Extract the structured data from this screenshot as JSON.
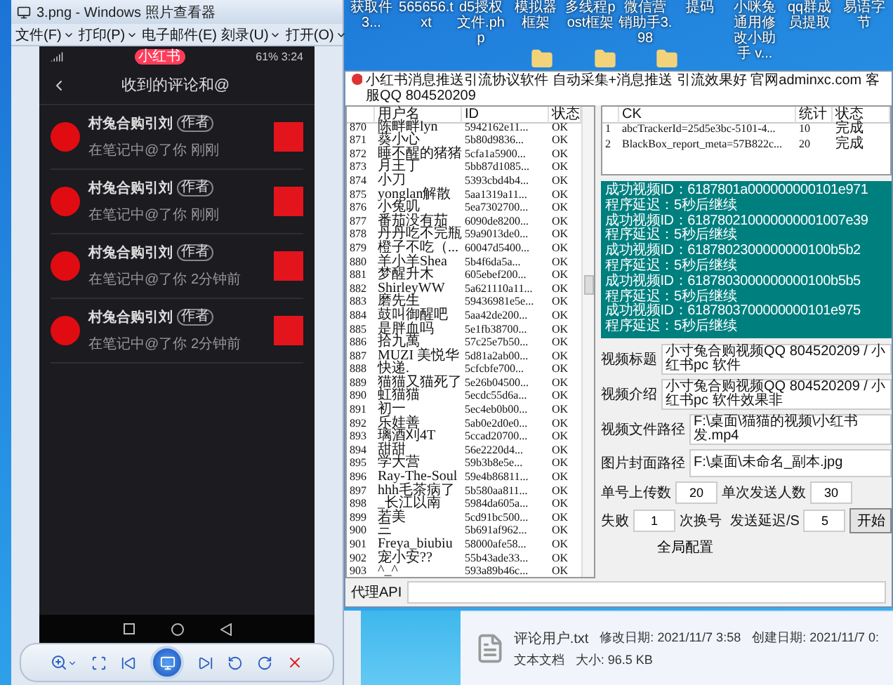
{
  "photo_viewer": {
    "title": "3.png - Windows 照片查看器",
    "menu": [
      {
        "label": "文件(F)",
        "dropdown": true
      },
      {
        "label": "打印(P)",
        "dropdown": true
      },
      {
        "label": "电子邮件(E)",
        "dropdown": false
      },
      {
        "label": "刻录(U)",
        "dropdown": true
      },
      {
        "label": "打开(O)",
        "dropdown": true
      }
    ],
    "phone": {
      "status_badge": "小红书",
      "battery": "61%",
      "time": "3:24",
      "header": "收到的评论和@",
      "comments": [
        {
          "name": "村兔合购引刘",
          "tag": "作者",
          "text": "在笔记中@了你",
          "time": "刚刚"
        },
        {
          "name": "村兔合购引刘",
          "tag": "作者",
          "text": "在笔记中@了你",
          "time": "刚刚"
        },
        {
          "name": "村兔合购引刘",
          "tag": "作者",
          "text": "在笔记中@了你",
          "time": "2分钟前"
        },
        {
          "name": "村兔合购引刘",
          "tag": "作者",
          "text": "在笔记中@了你",
          "time": "2分钟前"
        }
      ]
    }
  },
  "desktop_icons": [
    {
      "label": "获取件3..."
    },
    {
      "label": "565656.txt"
    },
    {
      "label": "d5授权文件.php"
    },
    {
      "label": "模拟器框架"
    },
    {
      "label": "多线程post框架"
    },
    {
      "label": "微信营销助手3.98"
    },
    {
      "label": "提码"
    },
    {
      "label": "小咪兔通用修改小助手 v..."
    },
    {
      "label": "qq群成员提取"
    },
    {
      "label": "易语字节"
    }
  ],
  "app": {
    "title": "小红书消息推送引流协议软件 自动采集+消息推送 引流效果好 官网adminxc.com 客服QQ 804520209",
    "users": {
      "columns": [
        "用户名",
        "ID",
        "状态"
      ],
      "rows": [
        {
          "no": "870",
          "name": "陈畔畔lyn",
          "id": "5942162e11...",
          "status": "OK"
        },
        {
          "no": "871",
          "name": "葵小心",
          "id": "5b80d9836...",
          "status": "OK"
        },
        {
          "no": "872",
          "name": "睡不醒的猪猪",
          "id": "5cfa1a5900...",
          "status": "OK"
        },
        {
          "no": "873",
          "name": "月王丁",
          "id": "5bb87d1085...",
          "status": "OK"
        },
        {
          "no": "874",
          "name": "小刀",
          "id": "5393cbd4b4...",
          "status": "OK"
        },
        {
          "no": "875",
          "name": "yonglan解散",
          "id": "5aa1319a11...",
          "status": "OK"
        },
        {
          "no": "876",
          "name": "小兔叽",
          "id": "5ea7302700...",
          "status": "OK"
        },
        {
          "no": "877",
          "name": "番茄没有茄",
          "id": "6090de8200...",
          "status": "OK"
        },
        {
          "no": "878",
          "name": "丹丹吃不完瓶",
          "id": "59a9013de0...",
          "status": "OK"
        },
        {
          "no": "879",
          "name": "橙子不吃（...",
          "id": "60047d5400...",
          "status": "OK"
        },
        {
          "no": "880",
          "name": "羊小羊Shea",
          "id": "5b4f6da5a...",
          "status": "OK"
        },
        {
          "no": "881",
          "name": "梦醒升木",
          "id": "605ebef200...",
          "status": "OK"
        },
        {
          "no": "882",
          "name": "ShirleyWW",
          "id": "5a621110a11...",
          "status": "OK"
        },
        {
          "no": "883",
          "name": "磨先生",
          "id": "59436981e5e...",
          "status": "OK"
        },
        {
          "no": "884",
          "name": "鼓叫御醒吧",
          "id": "5aa42de200...",
          "status": "OK"
        },
        {
          "no": "885",
          "name": "是胖血吗",
          "id": "5e1fb38700...",
          "status": "OK"
        },
        {
          "no": "886",
          "name": "拾九萬",
          "id": "57c25e7b50...",
          "status": "OK"
        },
        {
          "no": "887",
          "name": "MUZI 美悦华",
          "id": "5d81a2ab00...",
          "status": "OK"
        },
        {
          "no": "888",
          "name": "快递.",
          "id": "5cfcbfe700...",
          "status": "OK"
        },
        {
          "no": "889",
          "name": "猫猫又猫死了",
          "id": "5e26b04500...",
          "status": "OK"
        },
        {
          "no": "890",
          "name": "虹猫猫",
          "id": "5ecdc55d6a...",
          "status": "OK"
        },
        {
          "no": "891",
          "name": "初一",
          "id": "5ec4eb0b00...",
          "status": "OK"
        },
        {
          "no": "892",
          "name": "乐娃善",
          "id": "5ab0e2d0e0...",
          "status": "OK"
        },
        {
          "no": "893",
          "name": "璃酒刈4T",
          "id": "5ccad20700...",
          "status": "OK"
        },
        {
          "no": "894",
          "name": "甜甜",
          "id": "56e2220d4...",
          "status": "OK"
        },
        {
          "no": "895",
          "name": "学大营",
          "id": "59b3b8e5e...",
          "status": "OK"
        },
        {
          "no": "896",
          "name": "Ray-The-Soul",
          "id": "59e4b86811...",
          "status": "OK"
        },
        {
          "no": "897",
          "name": "hhh毛茶病了",
          "id": "5b580aa811...",
          "status": "OK"
        },
        {
          "no": "898",
          "name": "_长江以南",
          "id": "5984da605a...",
          "status": "OK"
        },
        {
          "no": "899",
          "name": "若美",
          "id": "5cd91bc500...",
          "status": "OK"
        },
        {
          "no": "900",
          "name": "三",
          "id": "5b691af962...",
          "status": "OK"
        },
        {
          "no": "901",
          "name": "Freya_biubiu",
          "id": "58000afe58...",
          "status": "OK"
        },
        {
          "no": "902",
          "name": "宠小安??",
          "id": "55b43ade33...",
          "status": "OK"
        },
        {
          "no": "903",
          "name": "^_^",
          "id": "593a89b46c...",
          "status": "OK"
        }
      ]
    },
    "ck_table": {
      "columns": [
        "CK",
        "统计",
        "状态"
      ],
      "rows": [
        {
          "no": "1",
          "ck": "abcTrackerId=25d5e3bc-5101-4...",
          "count": "10",
          "status": "完成"
        },
        {
          "no": "2",
          "ck": "BlackBox_report_meta=57B822c...",
          "count": "20",
          "status": "完成"
        }
      ]
    },
    "log": [
      "成功视频ID：6187801a000000000101e971",
      "程序延迟：5秒后继续",
      "成功视频ID：618780210000000001007e39",
      "程序延迟：5秒后继续",
      "成功视频ID：6187802300000000100b5b2",
      "程序延迟：5秒后继续",
      "成功视频ID：6187803000000000100b5b5",
      "程序延迟：5秒后继续",
      "成功视频ID：6187803700000000101e975",
      "程序延迟：5秒后继续"
    ],
    "form": {
      "fields": [
        {
          "label": "视频标题",
          "value": "小寸兔合购视频QQ 804520209 / 小红书pc 软件"
        },
        {
          "label": "视频介绍",
          "value": "小寸兔合购视频QQ 804520209 / 小红书pc 软件效果非"
        },
        {
          "label": "视频文件路径",
          "value": "F:\\桌面\\猫猫的视频\\小红书发.mp4"
        },
        {
          "label": "图片封面路径",
          "value": "F:\\桌面\\未命名_副本.jpg"
        }
      ],
      "upload_label": "单号上传数",
      "upload_value": "20",
      "send_label": "单次发送人数",
      "send_value": "30",
      "fail_label": "失败",
      "fail_value": "1",
      "fail_suffix": "次换号",
      "delay_label": "发送延迟/S",
      "delay_value": "5",
      "start_button": "开始",
      "group_label": "全局配置"
    },
    "proxy_label": "代理API"
  },
  "file_details": {
    "name": "评论用户.txt",
    "modified_label": "修改日期:",
    "modified": "2021/11/7 3:58",
    "created_label": "创建日期:",
    "created": "2021/11/7 0:",
    "type": "文本文档",
    "size_label": "大小:",
    "size": "96.5 KB"
  }
}
